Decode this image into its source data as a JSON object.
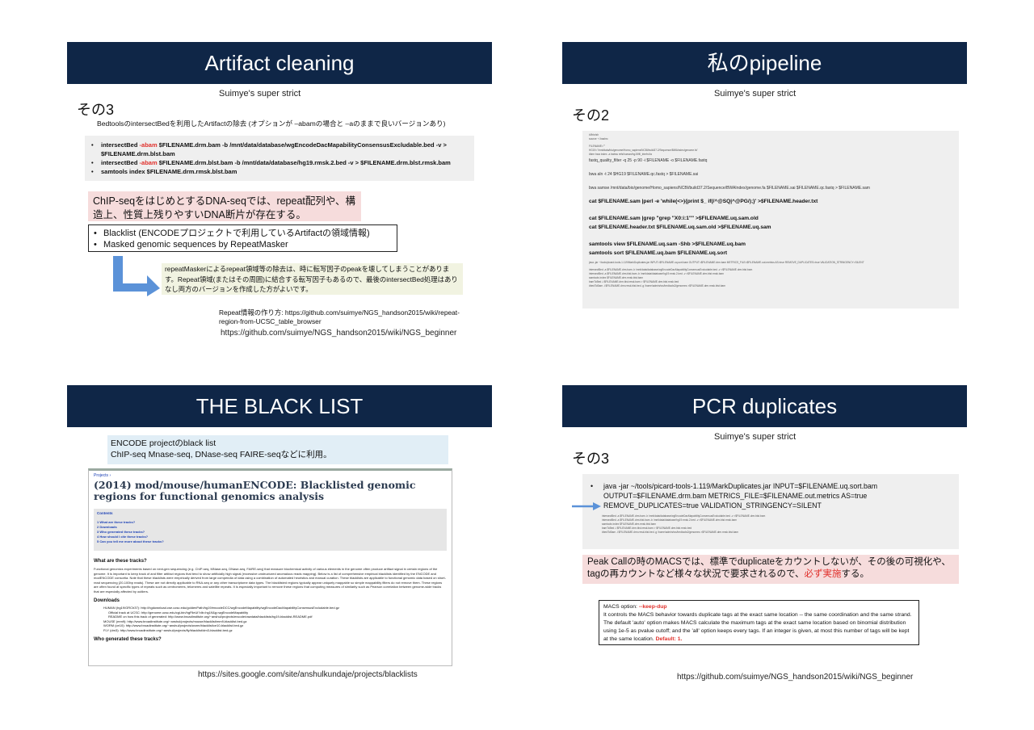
{
  "slides": [
    {
      "title": "Artifact cleaning",
      "subtitle": "Suimye's super strict",
      "section": "その3",
      "intro": "BedtoolsのintersectBedを利用したArtifactの除去 (オプションが –abamの場合と –aのままで良いバージョンあり)",
      "commands": [
        {
          "pre": "intersectBed ",
          "opt": "-abam",
          "post": " $FILENAME.drm.bam -b /mnt/data/database/wgEncodeDacMapabilityConsensusExcludable.bed -v > $FILENAME.drm.blst.bam"
        },
        {
          "pre": "intersectBed ",
          "opt": "-abam",
          "post": " $FILENAME.drm.blst.bam -b /mnt/data/database/hg19.rmsk.2.bed -v > $FILENAME.drm.blst.rmsk.bam"
        },
        {
          "pre": "samtools index $FILENAME.drm.rmsk.blst.bam",
          "opt": "",
          "post": ""
        }
      ],
      "pink_text": "ChIP-seqをはじめとするDNA-seqでは、repeat配列や、構造上、性質上残りやすいDNA断片が存在する。",
      "box_items": [
        "Blacklist (ENCODEプロジェクトで利用しているArtifactの領域情報)",
        "Masked genomic sequences by RepeatMasker"
      ],
      "note": "repeatMaskerによるrepeat領域等の除去は、時に転写因子のpeakを壊してしまうことがあります。Repeat領域(またはその周囲)に結合する転写因子もあるので、最後のintersectBed処理はありなし両方のバージョンを作成した方がよいです。",
      "repeat_info": "Repeat情報の作り方: https://github.com/suimye/NGS_handson2015/wiki/repeat-region-from-UCSC_table_browser",
      "url": "https://github.com/suimye/NGS_handson2015/wiki/NGS_beginner"
    },
    {
      "title": "私のpipeline",
      "subtitle": "Suimye's super strict",
      "section": "その2",
      "tiny_top": [
        "#!/bin/sh",
        "source ~/.bashrc",
        "FILENAME=\"\"",
        "HG19=\"/mnt/data/bio/genome/Homo_sapiens/NCBI/build37.2/Sequence/BWAIndex/genome.fa\"",
        "#bmr bwa index -a bwtsw refs/human/hg19/fil_trimfnl.fa",
        "fastq_quality_filter -q 25 -p 90 -i $FILENAME -o $FILENAME.fastq",
        "bwa aln -t 24 $HG19 $FILENAME.qc.fastq > $FILENAME.sai",
        "bwa samse /mnt/data/bio/genome/Homo_sapiens/NCBI/build37.2/Sequence/BWAIndex/genome.fa $FILENAME.sai $FILENAME.qc.fastq > $FILENAME.sam"
      ],
      "bold_cmds": [
        "cat $FILENAME.sam |perl -e 'while(<>){print $_ if(/^@SQ|^@PG/);}' >$FILENAME.header.txt",
        "cat $FILENAME.sam |grep \"grep \"X0:i:1\"\" >$FILENAME.uq.sam.old",
        "cat $FILENAME.header.txt $FILENAME.uq.sam.old >$FILENAME.uq.sam",
        "samtools view $FILENAME.uq.sam -Shb >$FILENAME.uq.bam",
        "samtools sort $FILENAME.uq.bam $FILENAME.uq.sort"
      ],
      "tiny_bottom": [
        "java -jar ~/tools/picard-tools-1.119/MarkDuplicates.jar INPUT=$FILENAME.uq.sort.bam OUTPUT=$FILENAME.drm.bam METRICS_FILE=$FILENAME.out.metrics AS=true REMOVE_DUPLICATES=true VALIDATION_STRINGENCY=SILENT",
        "intersectBed -a $FILENAME.drm.bam -b /mnt/data/database/wgEncodeDacMapabilityConsensusExcludable.bed -v >$FILENAME.drm.blst.bam",
        "intersectBed -a $FILENAME.drm.blst.bam -b /mnt/data/database/hg19.rmsk.2.bed -v >$FILENAME.drm.blst.rmsk.bam",
        "samtools index $FILENAME.drm.rmsk.blst.bam",
        "bamToBed -i $FILENAME.drm.blst.rmsk.bam > $FILENAME.drm.blst.rmsk.bed",
        "#bedToBam -i $FILENAME.drm.rmsk.blst.bed -g /home/admin/src/bedtools2/genomes >$FILENAME.drm.rmsk.blst.bam"
      ]
    },
    {
      "title": "THE BLACK LIST",
      "info_line1": "ENCODE projectのblack list",
      "info_line2": "ChIP-seq Mnase-seq, DNase-seq  FAIRE-seqなどに利用。",
      "page": {
        "crumb": "Projects ›",
        "heading": "(2014) mod/mouse/humanENCODE: Blacklisted genomic regions for functional genomics analysis",
        "contents_label": "Contents",
        "contents": [
          "1 What are these tracks?",
          "2 Downloads",
          "3 Who generated these tracks?",
          "4 How should I cite these tracks?",
          "5 Can you tell me more about these tracks?"
        ],
        "section1": "What are these tracks?",
        "paragraph": "Functional genomics experiments based on next-gen sequencing (e.g. ChIP-seq, MNase-seq, DNase-seq, FAIRE-seq) that measure biochemical activity of various elements in the genome often produce artifact signal in certain regions of the genome. It is important to keep track of and filter artifact regions that tend to show artificially high signal (excessive unstructured anomalous reads mapping). Below is a list of comprehensive empirical blacklists identified by the ENCODE and modENCODE consortia. Note that these blacklists were empirically derived from large compendia of data using a combination of automated heuristics and manual curation. These blacklists are applicable to functional genomic data based on short-read sequencing (20-100bp reads). These are not directly applicable to RNA-seq or any other transcriptome data types. The blacklisted regions typically appear uniquely mappable so simple mappability filters do not remove them. These regions are often found at specific types of repeats such as centromeres, telomeres and satellite repeats. It is especially important to remove these regions that computing measures of similarity such as Pearson correlation between genome-wide tracks that are especially affected by outliers.",
        "section2": "Downloads",
        "downloads": [
          "HUMAN (hg19/GRCh37): http://hgdownload.cse.ucsc.edu/goldenPath/hg19/encodeDCC/wgEncodeMapability/wgEncodeDacMapabilityConsensusExcludable.bed.gz",
          "Official track at UCSC: http://genome.ucsc.edu/cgi-bin/hgFileUi?db=hg19&g=wgEncodeMapability",
          "README on how this track of generated: http://www.broadinstitute.org/~anshul/projects/encode/rawdata/blacklists/hg19-blacklist-README.pdf",
          "MOUSE (mm9): http://www.broadinstitute.org/~anshul/projects/mouse/blacklist/mm9-blacklist.bed.gz",
          "WORM (ce10): http://www.broadinstitute.org/~anshul/projects/worm/blacklist/ce10-blacklist.bed.gz",
          "FLY (dm3): http://www.broadinstitute.org/~anshul/projects/fly/blacklist/dm3-blacklist.bed.gz"
        ],
        "section3": "Who generated these tracks?"
      },
      "url": "https://sites.google.com/site/anshulkundaje/projects/blacklists"
    },
    {
      "title": "PCR duplicates",
      "subtitle": "Suimye's super strict",
      "section": "その3",
      "java_cmd": "java -jar ~/tools/picard-tools-1.119/MarkDuplicates.jar INPUT=$FILENAME.uq.sort.bam OUTPUT=$FILENAME.drm.bam METRICS_FILE=$FILENAME.out.metrics AS=true REMOVE_DUPLICATES=true VALIDATION_STRINGENCY=SILENT",
      "tiny_cmds": [
        "intersectBed -a $FILENAME.drm.bam -b /mnt/data/database/wgEncodeDacMapabilityConsensusExcludable.bed -v >$FILENAME.drm.blst.bam",
        "intersectBed -a $FILENAME.drm.blst.bam -b /mnt/data/database/hg19.rmsk.2.bed -v >$FILENAME.drm.blst.rmsk.bam",
        "samtools index $FILENAME.drm.rmsk.blst.bam",
        "bamToBed -i $FILENAME.drm.blst.rmsk.bam > $FILENAME.drm.blst.rmsk.bed",
        "#bedToBam -i $FILENAME.drm.rmsk.blst.bed -g /home/admin/src/bedtools2/genomes >$FILENAME.drm.rmsk.blst.bam"
      ],
      "pink_pre": "Peak Callの時のMACSでは、標準でduplicateをカウントしないが、その後の可視化や、tagの再カウントなど様々な状況で要求されるので、",
      "pink_red": "必ず実施",
      "pink_post": "する。",
      "macs_label": "MACS option: ",
      "macs_opt": "--keep-dup",
      "macs_text": "It controls the MACS behavior towards duplicate tags at the exact same location -- the same coordination and the same strand. The default 'auto' option makes MACS calculate the maximum tags at the exact same location based on binomial distribution using 1e-5 as pvalue cutoff; and the 'all' option keeps every tags. If an integer is given, at most this number of tags will be kept at the same location. ",
      "macs_default": "Default: 1.",
      "url": "https://github.com/suimye/NGS_handson2015/wiki/NGS_beginner"
    }
  ],
  "colors": {
    "banner": "#0f2647",
    "pink": "#f6dcdc",
    "info": "#e1eef6",
    "arrow": "#5b92d8",
    "red": "#e0302b"
  }
}
